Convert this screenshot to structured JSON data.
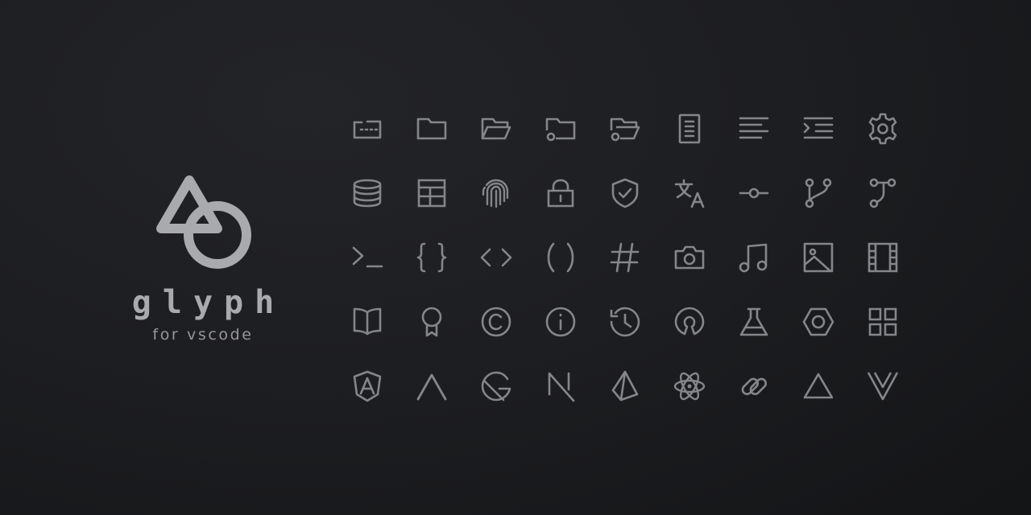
{
  "brand": {
    "name": "glyph",
    "subtitle": "for vscode"
  },
  "colors": {
    "icon": "#85868a",
    "logo": "#a9aaae",
    "background": "#1c1d20"
  },
  "icons": [
    "folder-dotted-icon",
    "folder-icon",
    "folder-open-icon",
    "folder-git-icon",
    "folder-git-open-icon",
    "document-icon",
    "text-align-left-icon",
    "indent-icon",
    "gear-icon",
    "database-icon",
    "table-icon",
    "fingerprint-icon",
    "lock-icon",
    "shield-check-icon",
    "translate-icon",
    "git-commit-icon",
    "git-branch-icon",
    "git-merge-icon",
    "terminal-icon",
    "braces-icon",
    "code-icon",
    "parentheses-icon",
    "hashtag-icon",
    "camera-icon",
    "music-note-icon",
    "image-icon",
    "film-icon",
    "book-open-icon",
    "award-icon",
    "copyright-icon",
    "info-icon",
    "history-icon",
    "open-source-icon",
    "flask-icon",
    "nut-icon",
    "grid-icon",
    "angular-icon",
    "chevron-up-icon",
    "gatsby-icon",
    "nextjs-icon",
    "prisma-icon",
    "react-icon",
    "link-icon",
    "triangle-icon",
    "vue-icon"
  ]
}
